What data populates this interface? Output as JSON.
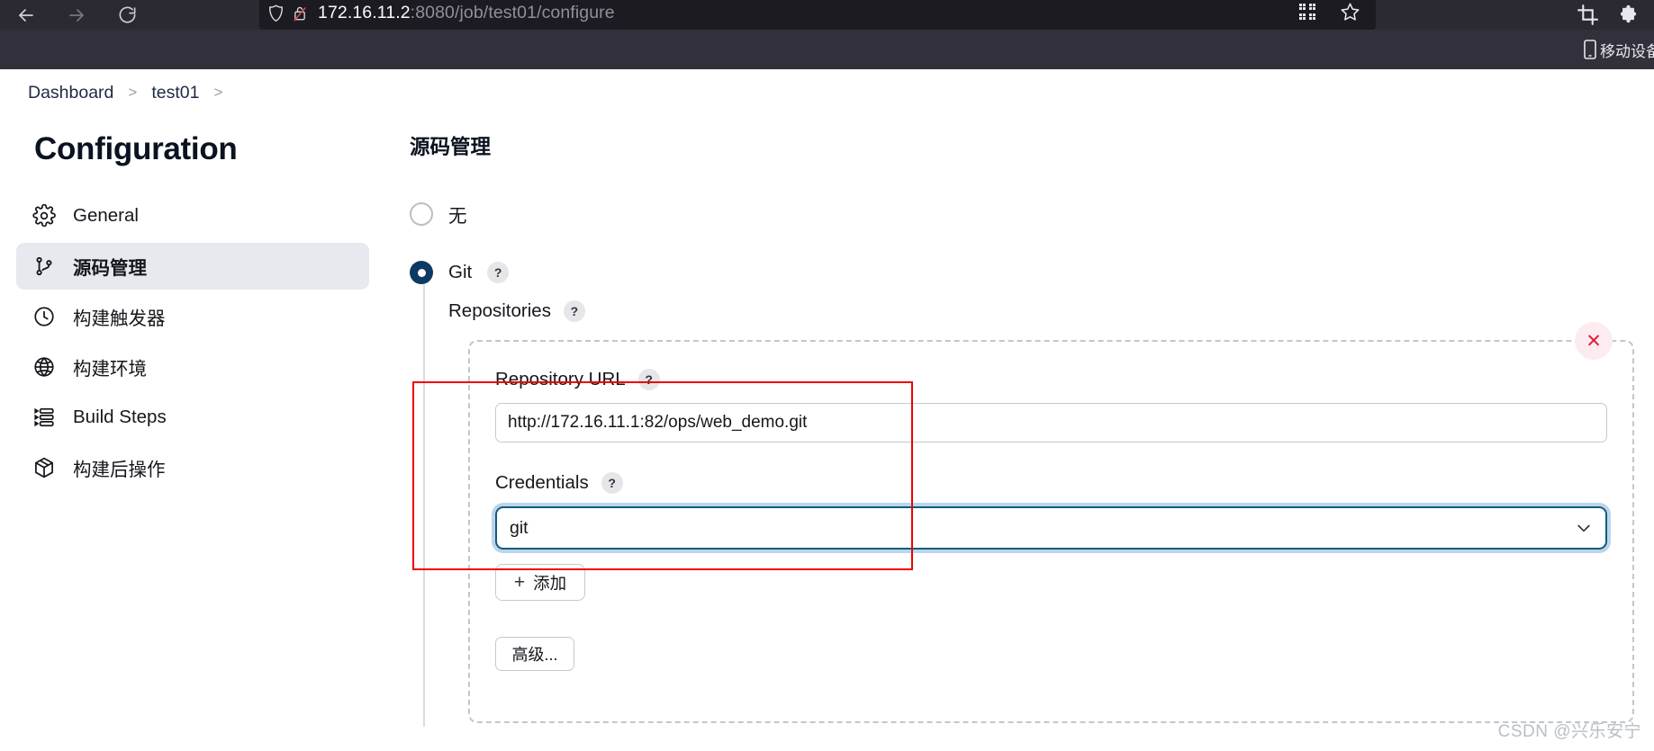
{
  "browser": {
    "back_icon": "back-arrow-icon",
    "forward_icon": "forward-arrow-icon",
    "reload_icon": "reload-icon",
    "back_glyph": "←",
    "forward_glyph": "→",
    "reload_glyph": "↻",
    "url_host": "172.16.11.2",
    "url_path": ":8080/job/test01/configure",
    "url_full": "172.16.11.2:8080/job/test01/configure",
    "shield_icon": "tracking-protection-shield-icon",
    "lock_icon": "broken-lock-icon",
    "qr_icon": "qr-code-icon",
    "bookmark_icon": "star-bookmark-icon",
    "crop_icon": "screenshot-crop-icon",
    "extension_icon": "extension-icon",
    "device_bar_label": "移动设备",
    "device_icon": "mobile-phone-icon"
  },
  "breadcrumb": {
    "items": [
      {
        "label": "Dashboard"
      },
      {
        "label": "test01"
      }
    ],
    "separator": ">"
  },
  "sidebar": {
    "title": "Configuration",
    "items": [
      {
        "label": "General",
        "icon": "gear-icon",
        "active": false
      },
      {
        "label": "源码管理",
        "icon": "git-branch-icon",
        "active": true
      },
      {
        "label": "构建触发器",
        "icon": "clock-icon",
        "active": false
      },
      {
        "label": "构建环境",
        "icon": "globe-icon",
        "active": false
      },
      {
        "label": "Build Steps",
        "icon": "list-steps-icon",
        "active": false
      },
      {
        "label": "构建后操作",
        "icon": "package-box-icon",
        "active": false
      }
    ]
  },
  "main": {
    "section_title": "源码管理",
    "scm_options": [
      {
        "label": "无",
        "checked": false,
        "has_help": false
      },
      {
        "label": "Git",
        "checked": true,
        "has_help": true
      }
    ],
    "help_glyph": "?",
    "repositories_label": "Repositories",
    "repo": {
      "delete_icon": "close-x-icon",
      "delete_glyph": "✕",
      "url_label": "Repository URL",
      "url_value": "http://172.16.11.1:82/ops/web_demo.git",
      "url_placeholder": "Repository URL",
      "credentials_label": "Credentials",
      "credentials_value": "git",
      "chevron_glyph": "⌄",
      "add_button": "添加",
      "add_plus": "+",
      "advanced_button": "高级..."
    }
  },
  "watermark": "CSDN @兴乐安宁",
  "colors": {
    "chrome_bg": "#2b2a33",
    "urlbar_bg": "#1c1b22",
    "device_strip_bg": "#31303b",
    "sidebar_active_bg": "#e8e9ee",
    "radio_checked": "#0d3a63",
    "annotation_red": "#ee0000",
    "delete_red": "#e01e3c",
    "focus_ring": "#bcd5ea"
  }
}
